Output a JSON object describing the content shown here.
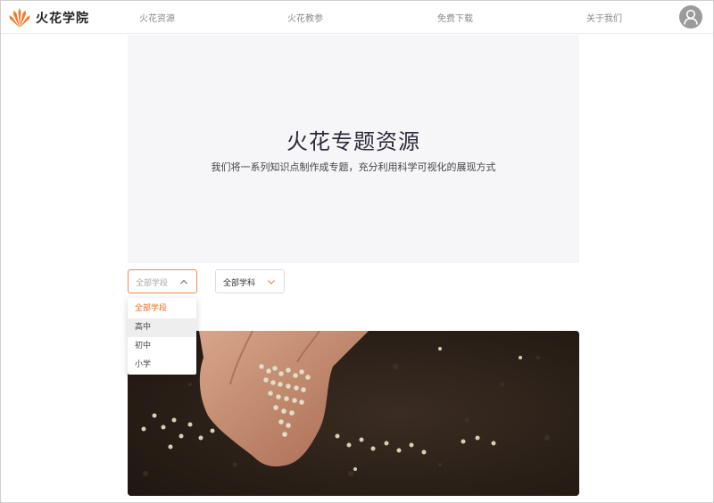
{
  "header": {
    "brand": "火花学院",
    "nav": [
      "火花资源",
      "火花教参",
      "免费下载",
      "关于我们"
    ]
  },
  "hero": {
    "title": "火花专题资源",
    "subtitle": "我们将一系列知识点制作成专题，充分利用科学可视化的展现方式"
  },
  "filters": {
    "stage": {
      "placeholder": "全部学段",
      "options": [
        "全部学段",
        "高中",
        "初中",
        "小学"
      ],
      "selected": "全部学段",
      "hovered": "高中"
    },
    "subject": {
      "value": "全部学科"
    }
  },
  "colors": {
    "accent": "#f06a1f",
    "logo": "#f07a2a",
    "avatar": "#9b9b9b"
  },
  "icons": {
    "logo": "flame-fan-logo",
    "avatar": "user-icon",
    "chevron_up": "chevron-up-icon",
    "chevron_down": "chevron-down-icon"
  }
}
